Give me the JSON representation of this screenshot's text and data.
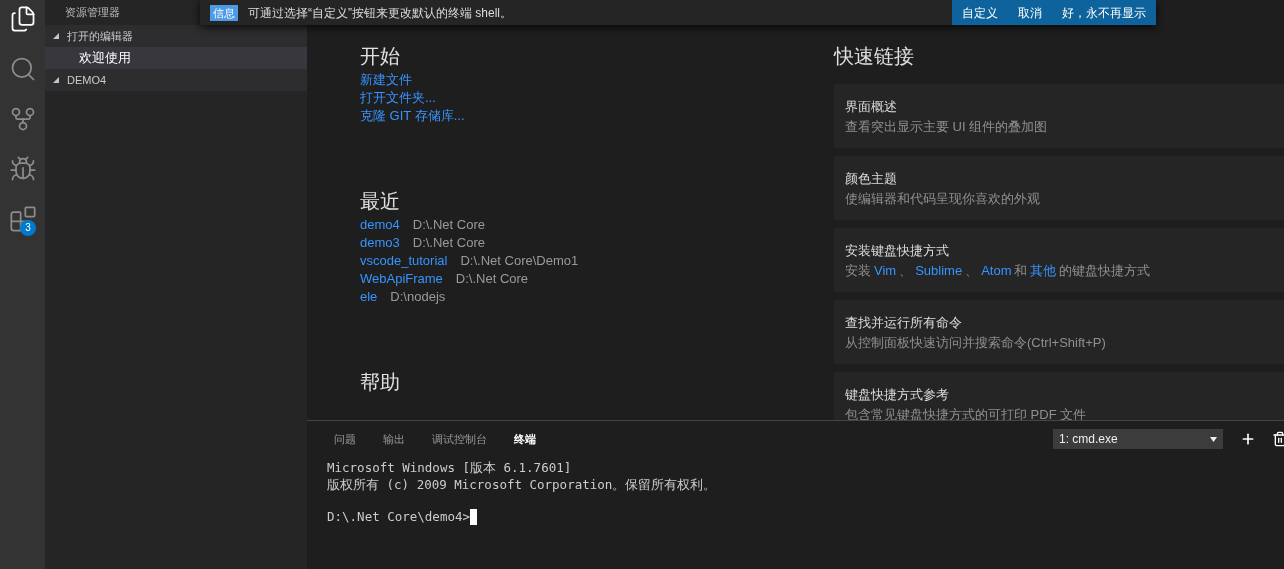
{
  "notification": {
    "badge": "信息",
    "message": "可通过选择“自定义”按钮来更改默认的终端 shell。",
    "actions": [
      "自定义",
      "取消",
      "好，永不再显示"
    ]
  },
  "activity_bar": [
    {
      "kind": "files"
    },
    {
      "kind": "search"
    },
    {
      "kind": "git"
    },
    {
      "kind": "debug"
    },
    {
      "kind": "extensions",
      "badge": "3"
    }
  ],
  "sidebar": {
    "title": "资源管理器",
    "sections": [
      {
        "label": "打开的编辑器",
        "expanded": true,
        "items": [
          {
            "label": "欢迎使用",
            "selected": true
          }
        ]
      },
      {
        "label": "DEMO4",
        "expanded": true
      }
    ]
  },
  "welcome": {
    "start": {
      "title": "开始",
      "links": [
        "新建文件",
        "打开文件夹...",
        "克隆 GIT 存储库..."
      ]
    },
    "recent": {
      "title": "最近",
      "items": [
        {
          "name": "demo4",
          "path": "D:\\.Net Core"
        },
        {
          "name": "demo3",
          "path": "D:\\.Net Core"
        },
        {
          "name": "vscode_tutorial",
          "path": "D:\\.Net Core\\Demo1"
        },
        {
          "name": "WebApiFrame",
          "path": "D:\\.Net Core"
        },
        {
          "name": "ele",
          "path": "D:\\nodejs"
        }
      ]
    },
    "help": {
      "title": "帮助"
    },
    "quick_links": {
      "title": "快速链接",
      "cards": [
        {
          "title": "界面概述",
          "description": [
            {
              "kind": "text",
              "text": "查看突出显示主要 UI 组件的叠加图"
            }
          ]
        },
        {
          "title": "颜色主题",
          "description": [
            {
              "kind": "text",
              "text": "使编辑器和代码呈现你喜欢的外观"
            }
          ]
        },
        {
          "title": "安装键盘快捷方式",
          "description": [
            {
              "kind": "text",
              "text": "安装"
            },
            {
              "kind": "link",
              "text": "Vim"
            },
            {
              "kind": "text",
              "text": "、"
            },
            {
              "kind": "link",
              "text": "Sublime"
            },
            {
              "kind": "text",
              "text": "、"
            },
            {
              "kind": "link",
              "text": "Atom"
            },
            {
              "kind": "text",
              "text": "和"
            },
            {
              "kind": "link",
              "text": "其他"
            },
            {
              "kind": "text",
              "text": "的键盘快捷方式"
            }
          ]
        },
        {
          "title": "查找并运行所有命令",
          "description": [
            {
              "kind": "text",
              "text": "从控制面板快速访问并搜索命令(Ctrl+Shift+P)"
            }
          ]
        },
        {
          "title": "键盘快捷方式参考",
          "description": [
            {
              "kind": "text",
              "text": "包含常见键盘快捷方式的可打印 PDF 文件"
            }
          ]
        }
      ]
    }
  },
  "panel": {
    "tabs": [
      {
        "label": "问题",
        "selected": false
      },
      {
        "label": "输出",
        "selected": false
      },
      {
        "label": "调试控制台",
        "selected": false
      },
      {
        "label": "终端",
        "selected": true
      }
    ],
    "terminal_select": "1: cmd.exe",
    "output_lines": [
      "Microsoft Windows [版本 6.1.7601]",
      "版权所有 (c) 2009 Microsoft Corporation。保留所有权利。"
    ],
    "prompt": "D:\\.Net Core\\demo4>"
  }
}
